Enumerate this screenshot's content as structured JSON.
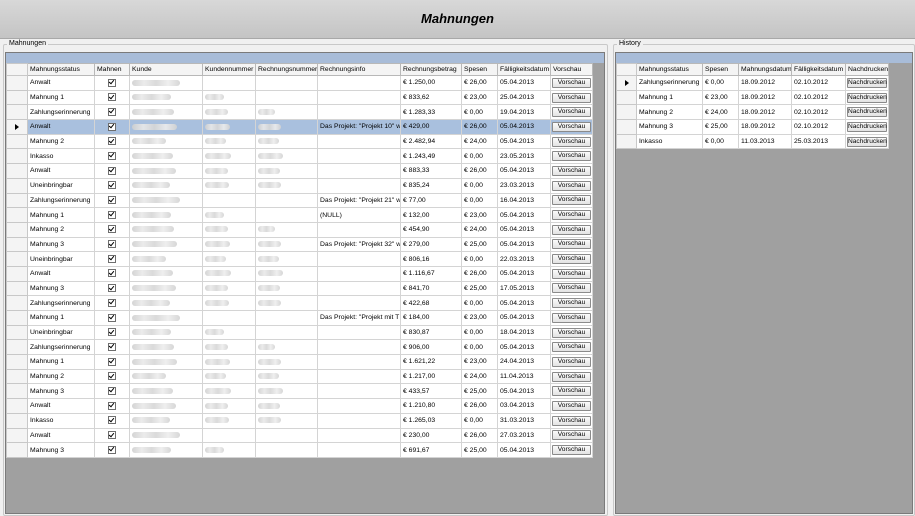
{
  "window": {
    "title": "Mahnungen"
  },
  "mahnungen": {
    "group_label": "Mahnungen",
    "columns": [
      "Mahnungsstatus",
      "Mahnen",
      "Kunde",
      "Kundennummer",
      "Rechnungsnummer",
      "Rechnungsinfo",
      "Rechnungsbetrag",
      "Spesen",
      "Fälligkeitsdatum",
      "Vorschau"
    ],
    "button_label": "Vorschau",
    "rows": [
      {
        "status": "Anwalt",
        "info": "",
        "betrag": "€ 1.250,00",
        "spesen": "€ 26,00",
        "datum": "05.04.2013"
      },
      {
        "status": "Mahnung 1",
        "info": "",
        "betrag": "€ 833,62",
        "spesen": "€ 23,00",
        "datum": "25.04.2013"
      },
      {
        "status": "Zahlungserinnerung",
        "info": "",
        "betrag": "€ 1.283,33",
        "spesen": "€ 0,00",
        "datum": "19.04.2013"
      },
      {
        "status": "Anwalt",
        "info": "Das Projekt: \"Projekt 10\" w",
        "betrag": "€ 429,00",
        "spesen": "€ 26,00",
        "datum": "05.04.2013",
        "selected": true
      },
      {
        "status": "Mahnung 2",
        "info": "",
        "betrag": "€ 2.482,94",
        "spesen": "€ 24,00",
        "datum": "05.04.2013"
      },
      {
        "status": "Inkasso",
        "info": "",
        "betrag": "€ 1.243,49",
        "spesen": "€ 0,00",
        "datum": "23.05.2013"
      },
      {
        "status": "Anwalt",
        "info": "",
        "betrag": "€ 883,33",
        "spesen": "€ 26,00",
        "datum": "05.04.2013"
      },
      {
        "status": "Uneinbringbar",
        "info": "",
        "betrag": "€ 835,24",
        "spesen": "€ 0,00",
        "datum": "23.03.2013"
      },
      {
        "status": "Zahlungserinnerung",
        "info": "Das Projekt: \"Projekt 21\" w",
        "betrag": "€ 77,00",
        "spesen": "€ 0,00",
        "datum": "16.04.2013"
      },
      {
        "status": "Mahnung 1",
        "info": "(NULL)",
        "betrag": "€ 132,00",
        "spesen": "€ 23,00",
        "datum": "05.04.2013"
      },
      {
        "status": "Mahnung 2",
        "info": "",
        "betrag": "€ 454,90",
        "spesen": "€ 24,00",
        "datum": "05.04.2013"
      },
      {
        "status": "Mahnung 3",
        "info": "Das Projekt: \"Projekt 32\" w",
        "betrag": "€ 279,00",
        "spesen": "€ 25,00",
        "datum": "05.04.2013"
      },
      {
        "status": "Uneinbringbar",
        "info": "",
        "betrag": "€ 806,16",
        "spesen": "€ 0,00",
        "datum": "22.03.2013"
      },
      {
        "status": "Anwalt",
        "info": "",
        "betrag": "€ 1.116,67",
        "spesen": "€ 26,00",
        "datum": "05.04.2013"
      },
      {
        "status": "Mahnung 3",
        "info": "",
        "betrag": "€ 841,70",
        "spesen": "€ 25,00",
        "datum": "17.05.2013"
      },
      {
        "status": "Zahlungserinnerung",
        "info": "",
        "betrag": "€ 422,68",
        "spesen": "€ 0,00",
        "datum": "05.04.2013"
      },
      {
        "status": "Mahnung 1",
        "info": "Das Projekt: \"Projekt mit T",
        "betrag": "€ 184,00",
        "spesen": "€ 23,00",
        "datum": "05.04.2013"
      },
      {
        "status": "Uneinbringbar",
        "info": "",
        "betrag": "€ 830,87",
        "spesen": "€ 0,00",
        "datum": "18.04.2013"
      },
      {
        "status": "Zahlungserinnerung",
        "info": "",
        "betrag": "€ 906,00",
        "spesen": "€ 0,00",
        "datum": "05.04.2013"
      },
      {
        "status": "Mahnung 1",
        "info": "",
        "betrag": "€ 1.621,22",
        "spesen": "€ 23,00",
        "datum": "24.04.2013"
      },
      {
        "status": "Mahnung 2",
        "info": "",
        "betrag": "€ 1.217,00",
        "spesen": "€ 24,00",
        "datum": "11.04.2013"
      },
      {
        "status": "Mahnung 3",
        "info": "",
        "betrag": "€ 433,57",
        "spesen": "€ 25,00",
        "datum": "05.04.2013"
      },
      {
        "status": "Anwalt",
        "info": "",
        "betrag": "€ 1.210,80",
        "spesen": "€ 26,00",
        "datum": "03.04.2013"
      },
      {
        "status": "Inkasso",
        "info": "",
        "betrag": "€ 1.265,03",
        "spesen": "€ 0,00",
        "datum": "31.03.2013"
      },
      {
        "status": "Anwalt",
        "info": "",
        "betrag": "€ 230,00",
        "spesen": "€ 26,00",
        "datum": "27.03.2013"
      },
      {
        "status": "Mahnung 3",
        "info": "",
        "betrag": "€ 691,67",
        "spesen": "€ 25,00",
        "datum": "05.04.2013"
      }
    ]
  },
  "history": {
    "group_label": "History",
    "columns": [
      "Mahnungsstatus",
      "Spesen",
      "Mahnungsdatum",
      "Fälligkeitsdatum",
      "Nachdrucken"
    ],
    "button_label": "Nachdrucken",
    "rows": [
      {
        "status": "Zahlungserinnerung",
        "spesen": "€ 0,00",
        "mdatum": "18.09.2012",
        "fdatum": "02.10.2012",
        "current": true
      },
      {
        "status": "Mahnung 1",
        "spesen": "€ 23,00",
        "mdatum": "18.09.2012",
        "fdatum": "02.10.2012"
      },
      {
        "status": "Mahnung 2",
        "spesen": "€ 24,00",
        "mdatum": "18.09.2012",
        "fdatum": "02.10.2012"
      },
      {
        "status": "Mahnung 3",
        "spesen": "€ 25,00",
        "mdatum": "18.09.2012",
        "fdatum": "02.10.2012"
      },
      {
        "status": "Inkasso",
        "spesen": "€ 0,00",
        "mdatum": "11.03.2013",
        "fdatum": "25.03.2013"
      }
    ]
  }
}
